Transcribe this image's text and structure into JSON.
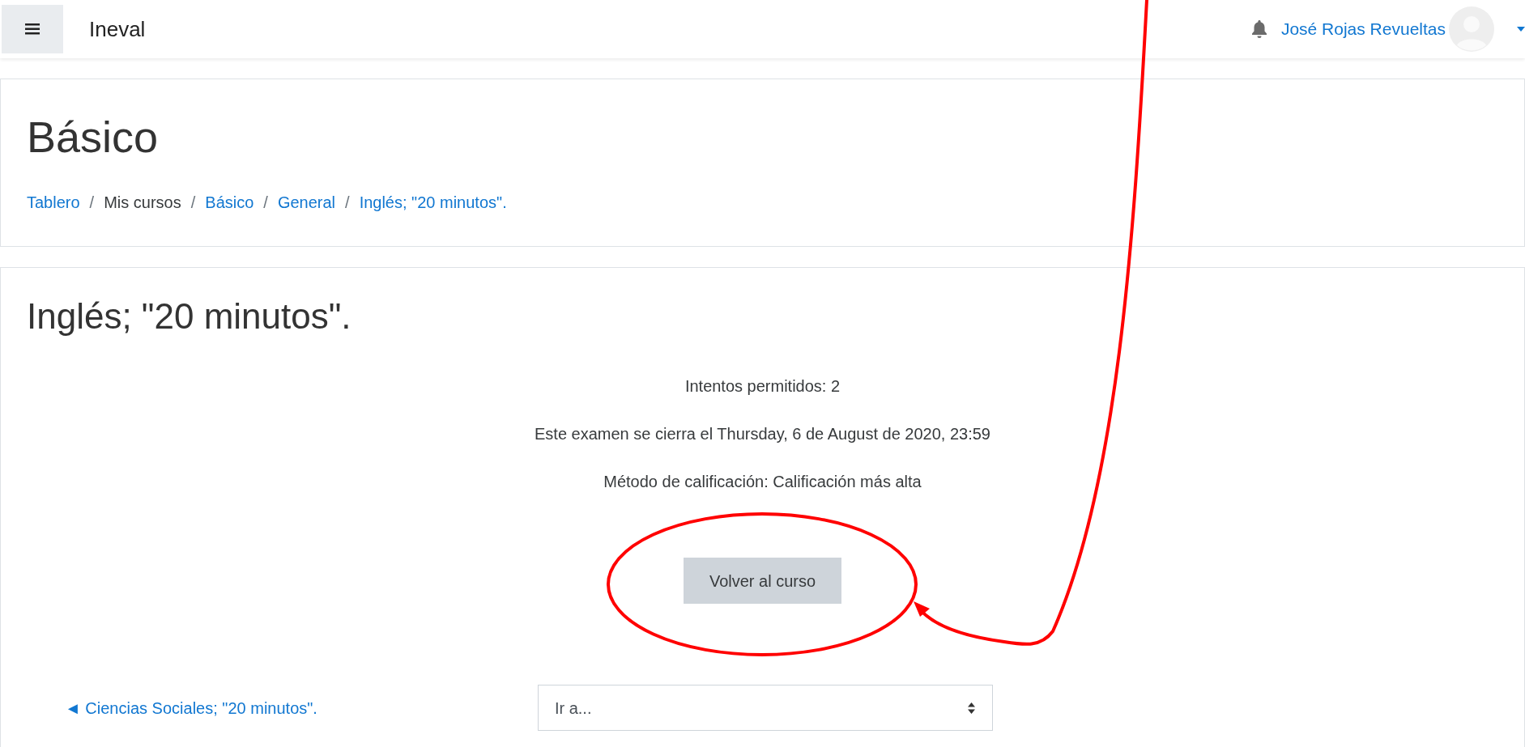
{
  "navbar": {
    "site_name": "Ineval",
    "user_name": "José Rojas Revueltas"
  },
  "header": {
    "title": "Básico",
    "separator": "/",
    "breadcrumb": [
      {
        "label": "Tablero",
        "link": true
      },
      {
        "label": "Mis cursos",
        "link": false
      },
      {
        "label": "Básico",
        "link": true
      },
      {
        "label": "General",
        "link": true
      },
      {
        "label": "Inglés; \"20 minutos\".",
        "link": true
      }
    ]
  },
  "quiz": {
    "title": "Inglés; \"20 minutos\".",
    "info": [
      "Intentos permitidos: 2",
      "Este examen se cierra el Thursday, 6 de August de 2020, 23:59",
      "Método de calificación: Calificación más alta"
    ],
    "button": "Volver al curso"
  },
  "footer_nav": {
    "previous_link": "◄ Ciencias Sociales; \"20 minutos\".",
    "jump_select": {
      "value": "Ir a..."
    }
  }
}
